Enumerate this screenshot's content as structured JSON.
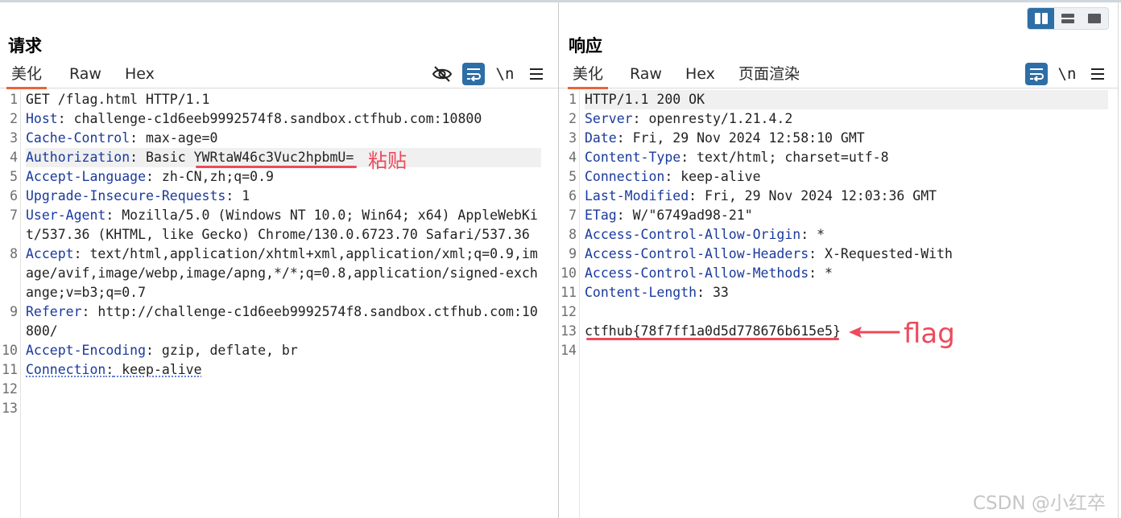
{
  "layout_toggle": {
    "options": [
      "side-by-side-icon",
      "stacked-icon",
      "single-pane-icon"
    ],
    "active": "side-by-side"
  },
  "request": {
    "title": "请求",
    "tabs": [
      "美化",
      "Raw",
      "Hex"
    ],
    "active_tab": "美化",
    "tools": [
      "hide-eye-icon",
      "wrap-icon",
      "\\n",
      "menu-icon"
    ],
    "lines": [
      {
        "n": "1",
        "key": "",
        "sep": "",
        "value": "GET /flag.html HTTP/1.1"
      },
      {
        "n": "2",
        "key": "Host",
        "sep": ":",
        "value": " challenge-c1d6eeb9992574f8.sandbox.ctfhub.com:10800"
      },
      {
        "n": "3",
        "key": "Cache-Control",
        "sep": ":",
        "value": " max-age=0"
      },
      {
        "n": "4",
        "key": "Authorization",
        "sep": ":",
        "value": " Basic YWRtaW46c3Vuc2hpbmU="
      },
      {
        "n": "5",
        "key": "Accept-Language",
        "sep": ":",
        "value": " zh-CN,zh;q=0.9"
      },
      {
        "n": "6",
        "key": "Upgrade-Insecure-Requests",
        "sep": ":",
        "value": " 1"
      },
      {
        "n": "7",
        "key": "User-Agent",
        "sep": ":",
        "value": " Mozilla/5.0 (Windows NT 10.0; Win64; x64) AppleWebKit/537.36 (KHTML, like Gecko) Chrome/130.0.6723.70 Safari/537.36"
      },
      {
        "n": "8",
        "key": "Accept",
        "sep": ":",
        "value": " text/html,application/xhtml+xml,application/xml;q=0.9,image/avif,image/webp,image/apng,*/*;q=0.8,application/signed-exchange;v=b3;q=0.7"
      },
      {
        "n": "9",
        "key": "Referer",
        "sep": ":",
        "value": " http://challenge-c1d6eeb9992574f8.sandbox.ctfhub.com:10800/"
      },
      {
        "n": "10",
        "key": "Accept-Encoding",
        "sep": ":",
        "value": " gzip, deflate, br"
      },
      {
        "n": "11",
        "key": "Connection",
        "sep": ":",
        "value": " keep-alive"
      },
      {
        "n": "12",
        "key": "",
        "sep": "",
        "value": ""
      },
      {
        "n": "13",
        "key": "",
        "sep": "",
        "value": ""
      }
    ]
  },
  "response": {
    "title": "响应",
    "tabs": [
      "美化",
      "Raw",
      "Hex",
      "页面渲染"
    ],
    "active_tab": "美化",
    "tools": [
      "wrap-icon",
      "\\n",
      "menu-icon"
    ],
    "lines": [
      {
        "n": "1",
        "key": "",
        "sep": "",
        "value": "HTTP/1.1 200 OK"
      },
      {
        "n": "2",
        "key": "Server",
        "sep": ":",
        "value": " openresty/1.21.4.2"
      },
      {
        "n": "3",
        "key": "Date",
        "sep": ":",
        "value": " Fri, 29 Nov 2024 12:58:10 GMT"
      },
      {
        "n": "4",
        "key": "Content-Type",
        "sep": ":",
        "value": " text/html; charset=utf-8"
      },
      {
        "n": "5",
        "key": "Connection",
        "sep": ":",
        "value": " keep-alive"
      },
      {
        "n": "6",
        "key": "Last-Modified",
        "sep": ":",
        "value": " Fri, 29 Nov 2024 12:03:36 GMT"
      },
      {
        "n": "7",
        "key": "ETag",
        "sep": ":",
        "value": " W/\"6749ad98-21\""
      },
      {
        "n": "8",
        "key": "Access-Control-Allow-Origin",
        "sep": ":",
        "value": " *"
      },
      {
        "n": "9",
        "key": "Access-Control-Allow-Headers",
        "sep": ":",
        "value": " X-Requested-With"
      },
      {
        "n": "10",
        "key": "Access-Control-Allow-Methods",
        "sep": ":",
        "value": " *"
      },
      {
        "n": "11",
        "key": "Content-Length",
        "sep": ":",
        "value": " 33"
      },
      {
        "n": "12",
        "key": "",
        "sep": "",
        "value": ""
      },
      {
        "n": "13",
        "key": "",
        "sep": "",
        "value": "ctfhub{78f7ff1a0d5d778676b615e5}"
      },
      {
        "n": "14",
        "key": "",
        "sep": "",
        "value": ""
      }
    ]
  },
  "annotations": {
    "paste_label": "粘贴",
    "flag_label": "flag",
    "color": "#ee4a5b"
  },
  "watermark": "CSDN @小红卒",
  "colors": {
    "accent_blue": "#2e6ea6",
    "header_key": "#1a3a9c",
    "active_tab_underline": "#e8653b"
  }
}
